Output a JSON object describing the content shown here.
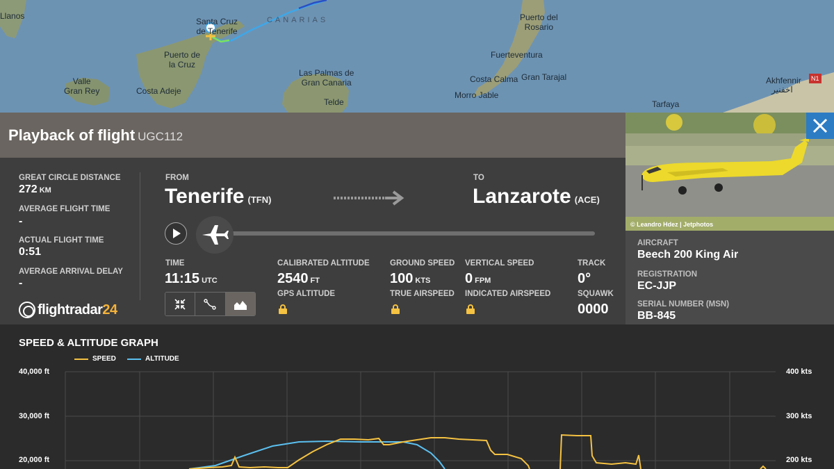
{
  "map": {
    "labels": {
      "santa_cruz": "Santa Cruz\nde Tenerife",
      "puerto_cruz": "Puerto de\nla Cruz",
      "costa_adeje": "Costa Adeje",
      "valle_gran_rey": "Valle\nGran Rey",
      "llanos": "Llanos",
      "canarias": "CANARIAS",
      "las_palmas": "Las Palmas de\nGran Canaria",
      "telde": "Telde",
      "puerto_rosario": "Puerto del\nRosario",
      "fuerteventura": "Fuerteventura",
      "costa_calma": "Costa Calma",
      "gran_tarajal": "Gran Tarajal",
      "morro_jable": "Morro Jable",
      "tarfaya": "Tarfaya",
      "akhfennir": "Akhfennir",
      "akhfennir_ar": "اخفنير",
      "road_badge": "N1"
    }
  },
  "panel": {
    "title": "Playback of flight",
    "flight_number": "UGC112",
    "great_circle_label": "GREAT CIRCLE DISTANCE",
    "great_circle_value": "272",
    "great_circle_unit": "KM",
    "avg_flight_time_label": "AVERAGE FLIGHT TIME",
    "avg_flight_time_value": "-",
    "actual_flight_time_label": "ACTUAL FLIGHT TIME",
    "actual_flight_time_value": "0:51",
    "avg_arrival_delay_label": "AVERAGE ARRIVAL DELAY",
    "avg_arrival_delay_value": "-",
    "from_label": "FROM",
    "from_city": "Tenerife",
    "from_code": "(TFN)",
    "to_label": "TO",
    "to_city": "Lanzarote",
    "to_code": "(ACE)",
    "time_label": "TIME",
    "time_value": "11:15",
    "time_unit": "UTC",
    "calibrated_altitude_label": "CALIBRATED ALTITUDE",
    "calibrated_altitude_value": "2540",
    "calibrated_altitude_unit": "FT",
    "gps_altitude_label": "GPS ALTITUDE",
    "ground_speed_label": "GROUND SPEED",
    "ground_speed_value": "100",
    "ground_speed_unit": "KTS",
    "true_airspeed_label": "TRUE AIRSPEED",
    "vertical_speed_label": "VERTICAL SPEED",
    "vertical_speed_value": "0",
    "vertical_speed_unit": "FPM",
    "indicated_airspeed_label": "INDICATED AIRSPEED",
    "track_label": "TRACK",
    "track_value": "0°",
    "squawk_label": "SQUAWK",
    "squawk_value": "0000",
    "logo_text": "flightradar",
    "logo_num": "24"
  },
  "aircraft": {
    "photo_credit": "© Leandro Hdez | Jetphotos",
    "aircraft_label": "AIRCRAFT",
    "aircraft_value": "Beech 200 King Air",
    "registration_label": "REGISTRATION",
    "registration_value": "EC-JJP",
    "serial_label": "SERIAL NUMBER (MSN)",
    "serial_value": "BB-845"
  },
  "graph": {
    "title": "SPEED & ALTITUDE GRAPH",
    "legend_speed": "SPEED",
    "legend_altitude": "ALTITUDE",
    "left_ticks": [
      "40,000 ft",
      "30,000 ft",
      "20,000 ft"
    ],
    "right_ticks": [
      "400 kts",
      "300 kts",
      "200 kts"
    ],
    "speed_color": "#f5c242",
    "altitude_color": "#5bc0f0"
  }
}
